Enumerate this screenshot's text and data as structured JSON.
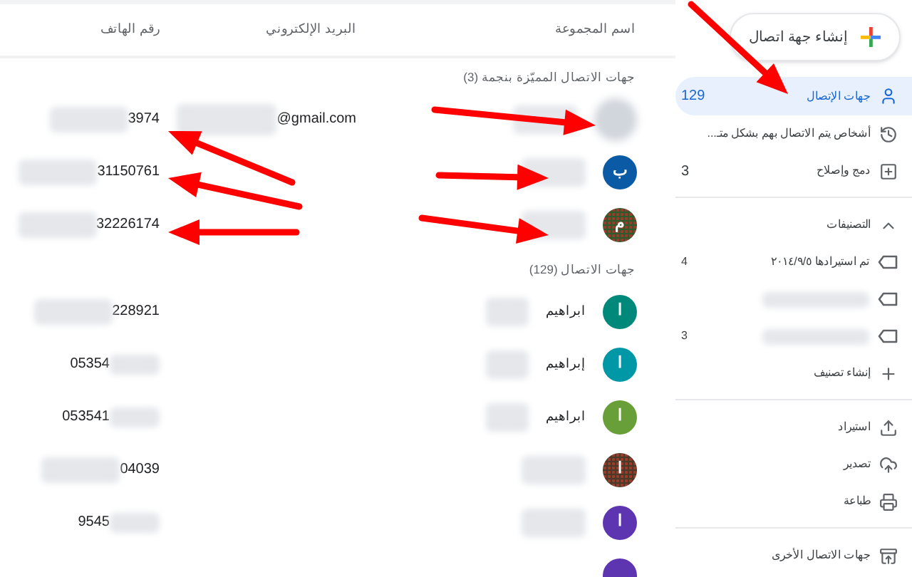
{
  "sidebar": {
    "create_button": "إنشاء جهة اتصال",
    "sections": [
      {
        "items": [
          {
            "kind": "nav",
            "text": "جهات الإتصال",
            "count": "129",
            "selected": true
          },
          {
            "kind": "nav",
            "text": "أشخاص يتم الاتصال بهم بشكل متـ...",
            "selected": false
          },
          {
            "kind": "nav",
            "text": "دمج وإصلاح",
            "count": "3",
            "selected": false
          }
        ]
      },
      {
        "items": [
          {
            "kind": "header",
            "text": "التصنيفات",
            "expanded": true
          },
          {
            "kind": "label",
            "text": "تم استيرادها ٢٠١٤/٩/٥",
            "count": "4",
            "blurred": false
          },
          {
            "kind": "label",
            "blurred": true
          },
          {
            "kind": "label",
            "count": "3",
            "blurred": true
          },
          {
            "kind": "action",
            "text": "إنشاء تصنيف"
          }
        ]
      },
      {
        "items": [
          {
            "kind": "nav",
            "text": "استيراد",
            "selected": false
          },
          {
            "kind": "nav",
            "text": "تصدير",
            "selected": false
          },
          {
            "kind": "nav",
            "text": "طباعة",
            "selected": false
          }
        ]
      },
      {
        "items": [
          {
            "kind": "nav",
            "text": "جهات الاتصال الأخرى",
            "selected": false
          }
        ]
      }
    ]
  },
  "columns": [
    "اسم المجموعة",
    "البريد الإلكتروني",
    "رقم الهاتف"
  ],
  "groups": [
    {
      "title": "جهات الاتصال المميّزة بنجمة (3)",
      "rows": [
        {
          "avatar": {
            "kind": "blurred"
          },
          "name_blurred": true,
          "email": "@gmail.com",
          "email_blurred": true,
          "phone": "3974",
          "phone_blur_before": true
        },
        {
          "avatar": {
            "kind": "letter",
            "letter": "ب",
            "color": "#0b5aa5"
          },
          "name_blurred": true,
          "phone": "31150761",
          "phone_blur_before": true
        },
        {
          "avatar": {
            "kind": "photo",
            "letter": "م",
            "color": "#2f5a2c"
          },
          "name_blurred": true,
          "phone": "32226174",
          "phone_blur_before": true
        }
      ]
    },
    {
      "title": "جهات الاتصال (129)",
      "rows": [
        {
          "avatar": {
            "kind": "letter",
            "letter": "ا",
            "color": "#00897b"
          },
          "name": "ابراهيم",
          "name_blurred": true,
          "phone": "228921",
          "phone_blur_before": true
        },
        {
          "avatar": {
            "kind": "letter",
            "letter": "ا",
            "color": "#0097a7"
          },
          "name": "إبراهيم",
          "name_blurred": true,
          "phone": "05354",
          "phone_blur_before": false
        },
        {
          "avatar": {
            "kind": "letter",
            "letter": "ا",
            "color": "#689f38"
          },
          "name": "ابراهيم",
          "name_blurred": true,
          "phone": "053541",
          "phone_blur_before": false
        },
        {
          "avatar": {
            "kind": "photo",
            "letter": "ا",
            "color": "#4a3a2a"
          },
          "name_blurred": true,
          "phone": "04039",
          "phone_blur_before": true
        },
        {
          "avatar": {
            "kind": "letter",
            "letter": "ا",
            "color": "#5e35b1"
          },
          "name_blurred": true,
          "phone": "9545",
          "phone_blur_before": false
        },
        {
          "avatar": {
            "kind": "letter",
            "color": "#5e35b1"
          }
        }
      ]
    }
  ]
}
